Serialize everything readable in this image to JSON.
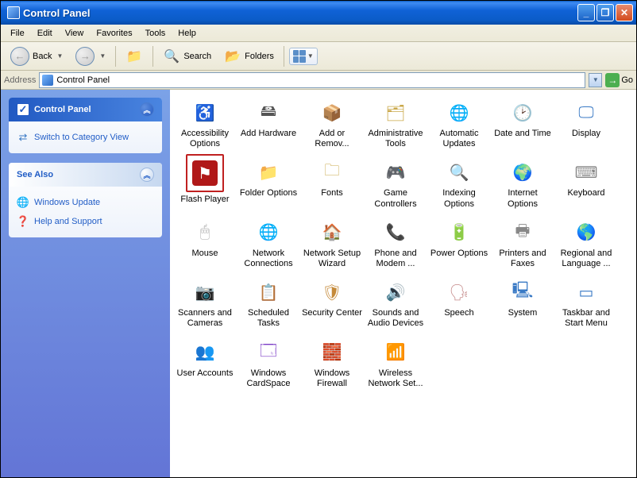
{
  "window": {
    "title": "Control Panel"
  },
  "menu": [
    "File",
    "Edit",
    "View",
    "Favorites",
    "Tools",
    "Help"
  ],
  "toolbar": {
    "back": "Back",
    "search": "Search",
    "folders": "Folders"
  },
  "addressbar": {
    "label": "Address",
    "value": "Control Panel",
    "go": "Go"
  },
  "sidebar": {
    "panel1": {
      "title": "Control Panel",
      "link": "Switch to Category View"
    },
    "panel2": {
      "title": "See Also",
      "links": [
        "Windows Update",
        "Help and Support"
      ]
    }
  },
  "items": [
    {
      "label": "Accessibility Options",
      "icon": "♿",
      "color": "#3a9a3a",
      "h": false
    },
    {
      "label": "Add Hardware",
      "icon": "🖴",
      "color": "#555",
      "h": false
    },
    {
      "label": "Add or Remov...",
      "icon": "📦",
      "color": "#caa84a",
      "h": false
    },
    {
      "label": "Administrative Tools",
      "icon": "🗂",
      "color": "#caa84a",
      "h": false
    },
    {
      "label": "Automatic Updates",
      "icon": "🌐",
      "color": "#3a7ac5",
      "h": false
    },
    {
      "label": "Date and Time",
      "icon": "🕑",
      "color": "#3a7ac5",
      "h": false
    },
    {
      "label": "Display",
      "icon": "🖵",
      "color": "#3a7ac5",
      "h": false
    },
    {
      "label": "Flash Player",
      "icon": "⚑",
      "color": "#b01818",
      "h": true
    },
    {
      "label": "Folder Options",
      "icon": "📁",
      "color": "#caa84a",
      "h": false
    },
    {
      "label": "Fonts",
      "icon": "🗀",
      "color": "#caa84a",
      "h": false
    },
    {
      "label": "Game Controllers",
      "icon": "🎮",
      "color": "#888",
      "h": false
    },
    {
      "label": "Indexing Options",
      "icon": "🔍",
      "color": "#4a7ac5",
      "h": false
    },
    {
      "label": "Internet Options",
      "icon": "🌍",
      "color": "#3a9a3a",
      "h": false
    },
    {
      "label": "Keyboard",
      "icon": "⌨",
      "color": "#888",
      "h": false
    },
    {
      "label": "Mouse",
      "icon": "🖱",
      "color": "#aaa",
      "h": false
    },
    {
      "label": "Network Connections",
      "icon": "🌐",
      "color": "#3a7ac5",
      "h": false
    },
    {
      "label": "Network Setup Wizard",
      "icon": "🏠",
      "color": "#c58a3a",
      "h": false
    },
    {
      "label": "Phone and Modem ...",
      "icon": "📞",
      "color": "#888",
      "h": false
    },
    {
      "label": "Power Options",
      "icon": "🔋",
      "color": "#3a9a3a",
      "h": false
    },
    {
      "label": "Printers and Faxes",
      "icon": "🖶",
      "color": "#888",
      "h": false
    },
    {
      "label": "Regional and Language ...",
      "icon": "🌎",
      "color": "#3a7ac5",
      "h": false
    },
    {
      "label": "Scanners and Cameras",
      "icon": "📷",
      "color": "#caa84a",
      "h": false
    },
    {
      "label": "Scheduled Tasks",
      "icon": "📋",
      "color": "#caa84a",
      "h": false
    },
    {
      "label": "Security Center",
      "icon": "🛡",
      "color": "#c58a3a",
      "h": false
    },
    {
      "label": "Sounds and Audio Devices",
      "icon": "🔊",
      "color": "#888",
      "h": false
    },
    {
      "label": "Speech",
      "icon": "🗣",
      "color": "#c58a8a",
      "h": false
    },
    {
      "label": "System",
      "icon": "🖳",
      "color": "#3a7ac5",
      "h": false
    },
    {
      "label": "Taskbar and Start Menu",
      "icon": "▭",
      "color": "#3a7ac5",
      "h": false
    },
    {
      "label": "User Accounts",
      "icon": "👥",
      "color": "#c58a3a",
      "h": false
    },
    {
      "label": "Windows CardSpace",
      "icon": "🗔",
      "color": "#7a3ac5",
      "h": false
    },
    {
      "label": "Windows Firewall",
      "icon": "🧱",
      "color": "#c55a3a",
      "h": false
    },
    {
      "label": "Wireless Network Set...",
      "icon": "📶",
      "color": "#888",
      "h": false
    }
  ]
}
